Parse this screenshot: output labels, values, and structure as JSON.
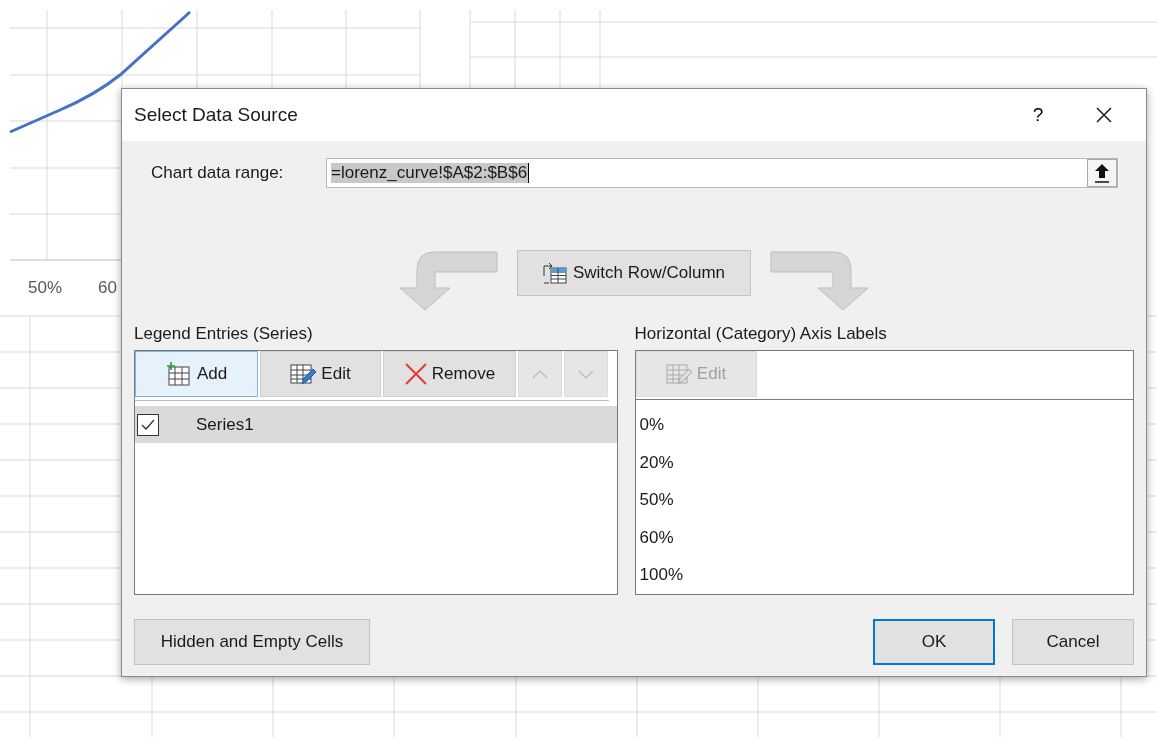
{
  "background": {
    "axis_labels": [
      "50%",
      "60"
    ]
  },
  "dialog": {
    "title": "Select Data Source",
    "help": "?",
    "chart_data_range": {
      "label": "Chart data range:",
      "value": "=lorenz_curve!$A$2:$B$6"
    },
    "switch_button": "Switch Row/Column",
    "legend": {
      "heading": "Legend Entries (Series)",
      "toolbar": [
        {
          "kind": "add",
          "label": "Add",
          "selected": true,
          "disabled": false
        },
        {
          "kind": "edit",
          "label": "Edit",
          "selected": false,
          "disabled": false
        },
        {
          "kind": "remove",
          "label": "Remove",
          "selected": false,
          "disabled": false
        },
        {
          "kind": "up",
          "selected": false,
          "disabled": true
        },
        {
          "kind": "down",
          "selected": false,
          "disabled": true
        }
      ],
      "series": [
        {
          "label": "Series1",
          "checked": true,
          "selected": true
        }
      ]
    },
    "axis": {
      "heading": "Horizontal (Category) Axis Labels",
      "edit_button": {
        "label": "Edit",
        "disabled": true
      },
      "labels": [
        "0%",
        "20%",
        "50%",
        "60%",
        "100%"
      ]
    },
    "buttons": [
      {
        "kind": "hidden",
        "label": "Hidden and Empty Cells",
        "default": false
      },
      {
        "kind": "ok",
        "label": "OK",
        "default": true
      },
      {
        "kind": "cancel",
        "label": "Cancel",
        "default": false
      }
    ]
  }
}
